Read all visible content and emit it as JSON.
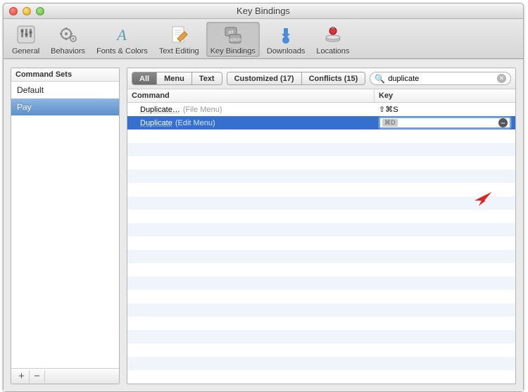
{
  "window": {
    "title": "Key Bindings"
  },
  "toolbar": {
    "items": [
      {
        "label": "General"
      },
      {
        "label": "Behaviors"
      },
      {
        "label": "Fonts & Colors"
      },
      {
        "label": "Text Editing"
      },
      {
        "label": "Key Bindings"
      },
      {
        "label": "Downloads"
      },
      {
        "label": "Locations"
      }
    ]
  },
  "sidebar": {
    "header": "Command Sets",
    "items": [
      {
        "name": "Default"
      },
      {
        "name": "Pay"
      }
    ],
    "add": "+",
    "remove": "−"
  },
  "filter": {
    "all": "All",
    "menu": "Menu",
    "text": "Text",
    "customized": "Customized (17)",
    "conflicts": "Conflicts (15)"
  },
  "search": {
    "placeholder": "",
    "value": "duplicate"
  },
  "columns": {
    "command": "Command",
    "key": "Key"
  },
  "rows": [
    {
      "command": "Duplicate…",
      "context": "(File Menu)",
      "key": "⇧⌘S",
      "selected": false
    },
    {
      "command": "Duplicate",
      "context": "(Edit Menu)",
      "key": "⌘D",
      "selected": true,
      "editing": true
    }
  ]
}
